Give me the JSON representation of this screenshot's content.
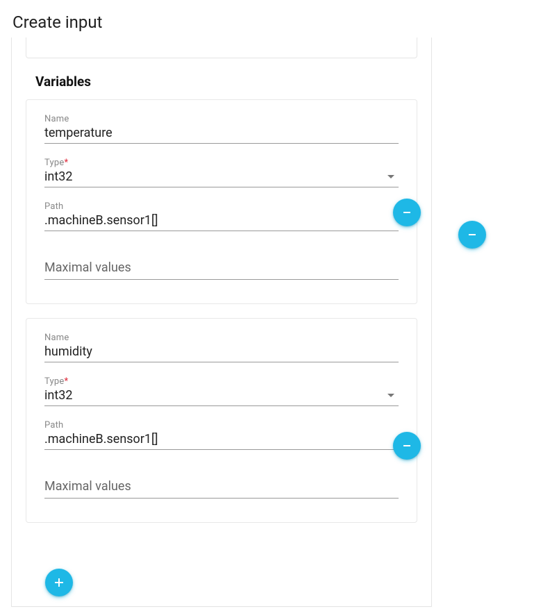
{
  "page": {
    "title": "Create input"
  },
  "section": {
    "title": "Variables"
  },
  "labels": {
    "name": "Name",
    "type": "Type",
    "required_mark": "*",
    "path": "Path",
    "max_placeholder": "Maximal values"
  },
  "variables": [
    {
      "name": "temperature",
      "type": "int32",
      "path": ".machineB.sensor1[]",
      "max_values": ""
    },
    {
      "name": "humidity",
      "type": "int32",
      "path": ".machineB.sensor1[]",
      "max_values": ""
    }
  ],
  "icons": {
    "add": "plus-icon",
    "remove": "minus-icon"
  },
  "colors": {
    "accent": "#1eb8e6"
  }
}
